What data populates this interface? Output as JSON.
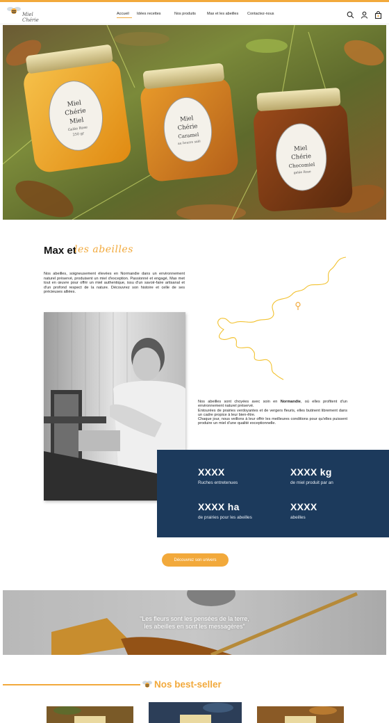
{
  "brand": {
    "name": "Miel Chérie",
    "accent": "#f2a93b",
    "navy": "#1c3a5c"
  },
  "nav": {
    "items": [
      "Accueil",
      "Idées recettes",
      "Nos produits",
      "Max et les abeilles",
      "Contactez-nous"
    ],
    "active": "Accueil"
  },
  "header_icons": [
    "search-icon",
    "user-icon",
    "bag-icon"
  ],
  "hero": {
    "jar_labels": [
      {
        "line1": "Miel",
        "line2": "Chérie",
        "line3": "Miel",
        "line4": "Gelée Rose",
        "line5": "250 gr"
      },
      {
        "line1": "Miel",
        "line2": "Chérie",
        "line3": "Caramel",
        "line4": "au beurre salé",
        "line5": ""
      },
      {
        "line1": "Miel",
        "line2": "Chérie",
        "line3": "Chocomiel",
        "line4": "gelée Rose",
        "line5": ""
      }
    ]
  },
  "about": {
    "title": "Max et",
    "title_script": "les abeilles",
    "intro": "Nos abeilles, soigneusement élevées en Normandie dans un environnement naturel préservé, produisent un miel d'exception. Passionné et engagé, Max met tout en œuvre pour offrir un miel authentique, issu d'un savoir-faire artisanal et d'un profond respect de la nature. Découvrez son histoire et celle de ses précieuses alliées.",
    "normandie_before": "Nos abeilles sont choyées avec soin en ",
    "normandie_bold": "Normandie",
    "normandie_after": ", où elles profitent d'un environnement naturel préservé.",
    "normandie_p2": "Entourées de prairies verdoyantes et de vergers fleuris, elles butinent librement dans un cadre propice à leur bien-être.",
    "normandie_p3": "Chaque jour, nous veillons à leur offrir les meilleures conditions pour qu'elles puissent produire un miel d'une qualité exceptionnelle."
  },
  "stats": [
    {
      "value": "XXXX",
      "label": "Ruches entretenues"
    },
    {
      "value": "XXXX kg",
      "label": "de miel produit par an"
    },
    {
      "value": "XXXX ha",
      "label": "de prairies pour les abeilles"
    },
    {
      "value": "XXXX",
      "label": "abeilles"
    }
  ],
  "cta": {
    "label": "Découvrez son univers"
  },
  "quote": {
    "line1": "“Les fleurs sont les pensées de la terre,",
    "line2": "les abeilles en sont les messagères”"
  },
  "bestsellers": {
    "title": "Nos best-seller"
  }
}
